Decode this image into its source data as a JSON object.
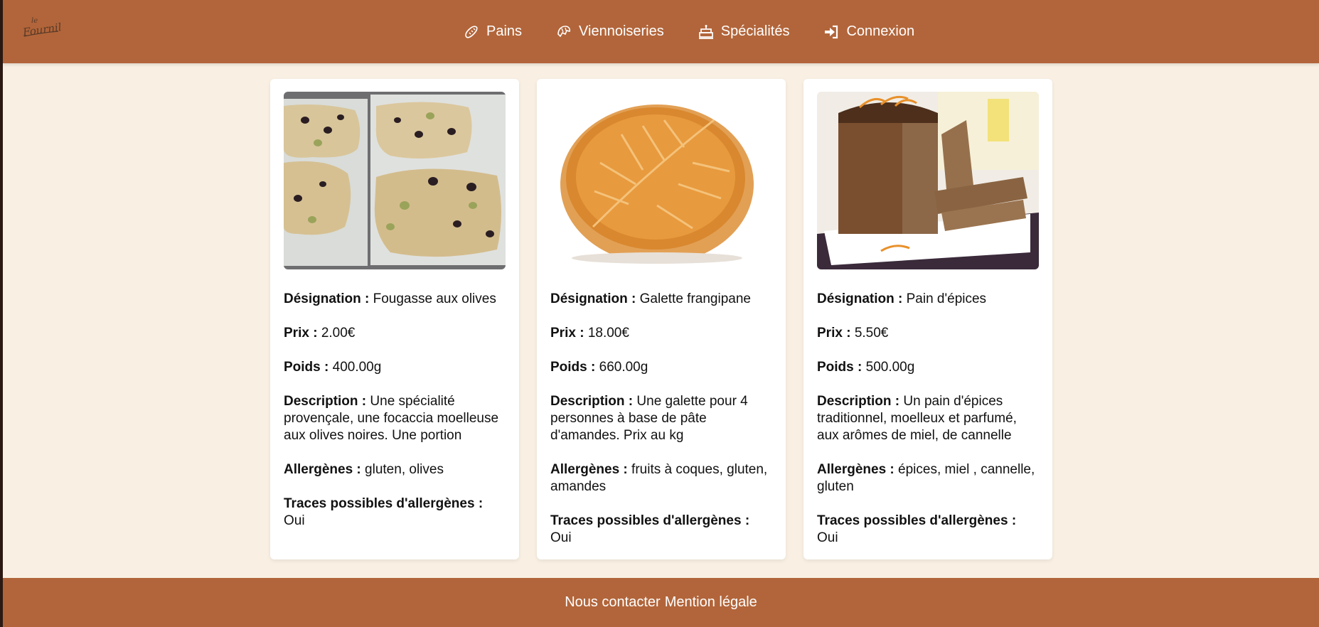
{
  "brand": {
    "logo_text_top": "le",
    "logo_text_main": "Fournil",
    "header_color": "#b2653a",
    "background_color": "#f9f0e3"
  },
  "nav": {
    "items": [
      {
        "label": "Pains",
        "icon": "baguette-icon"
      },
      {
        "label": "Viennoiseries",
        "icon": "croissant-icon"
      },
      {
        "label": "Spécialités",
        "icon": "cake-icon"
      },
      {
        "label": "Connexion",
        "icon": "sign-in-icon"
      }
    ]
  },
  "products": [
    {
      "image": "fougasse-image",
      "designation_label": "Désignation :",
      "designation": "Fougasse aux olives",
      "prix_label": "Prix :",
      "prix": "2.00€",
      "poids_label": "Poids :",
      "poids": "400.00g",
      "description_label": "Description :",
      "description": "Une spécialité provençale, une focaccia moelleuse aux olives noires. Une portion",
      "allergenes_label": "Allergènes :",
      "allergenes": "gluten, olives",
      "traces_label": "Traces possibles d'allergènes :",
      "traces": "Oui"
    },
    {
      "image": "galette-image",
      "designation_label": "Désignation :",
      "designation": "Galette frangipane",
      "prix_label": "Prix :",
      "prix": "18.00€",
      "poids_label": "Poids :",
      "poids": "660.00g",
      "description_label": "Description :",
      "description": "Une galette pour 4 personnes à base de pâte d'amandes. Prix au kg",
      "allergenes_label": "Allergènes :",
      "allergenes": "fruits à coques, gluten, amandes",
      "traces_label": "Traces possibles d'allergènes :",
      "traces": "Oui"
    },
    {
      "image": "pain-epices-image",
      "designation_label": "Désignation :",
      "designation": "Pain d'épices",
      "prix_label": "Prix :",
      "prix": "5.50€",
      "poids_label": "Poids :",
      "poids": "500.00g",
      "description_label": "Description :",
      "description": "Un pain d'épices traditionnel, moelleux et parfumé, aux arômes de miel, de cannelle",
      "allergenes_label": "Allergènes :",
      "allergenes": "épices, miel , cannelle, gluten",
      "traces_label": "Traces possibles d'allergènes :",
      "traces": "Oui"
    }
  ],
  "footer": {
    "contact_label": "Nous contacter",
    "legal_label": "Mention légale"
  }
}
